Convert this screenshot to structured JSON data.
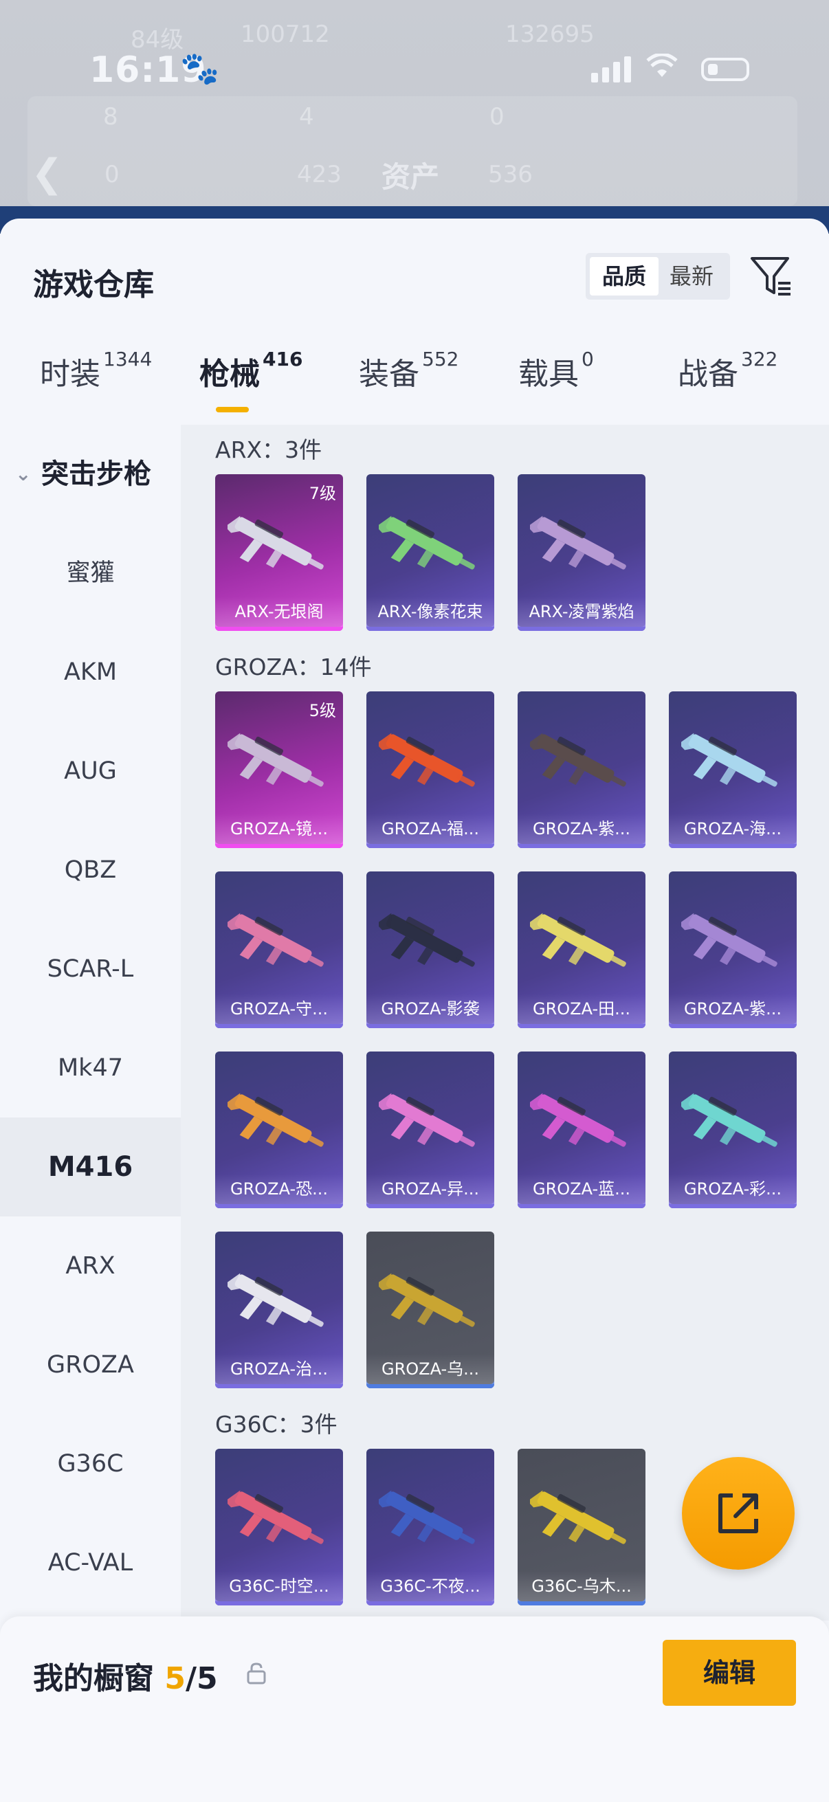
{
  "status_bar": {
    "time": "16:19",
    "paw_icon": "paw-icon"
  },
  "background": {
    "level_text": "84级",
    "stat_1": "100712",
    "stat_2": "132695",
    "values": [
      "8",
      "4",
      "0",
      "0",
      "423",
      "536"
    ],
    "asset_title": "资产"
  },
  "sheet": {
    "title": "游戏仓库",
    "sort_options": [
      "品质",
      "最新"
    ],
    "tabs": [
      {
        "label": "时装",
        "count": "1344"
      },
      {
        "label": "枪械",
        "count": "416"
      },
      {
        "label": "装备",
        "count": "552"
      },
      {
        "label": "载具",
        "count": "0"
      },
      {
        "label": "战备",
        "count": "322"
      }
    ]
  },
  "sidebar": {
    "header": "突击步枪",
    "items": [
      "蜜獾",
      "AKM",
      "AUG",
      "QBZ",
      "SCAR-L",
      "Mk47",
      "M416",
      "ARX",
      "GROZA",
      "G36C",
      "AC-VAL"
    ],
    "selected": "M416"
  },
  "groups": [
    {
      "label": "ARX：3件",
      "items": [
        {
          "name": "ARX-无垠阁",
          "level": "7级",
          "rarity": "purple",
          "color": "#d9d9e6"
        },
        {
          "name": "ARX-像素花束",
          "level": "",
          "rarity": "blue",
          "color": "#7fd27a"
        },
        {
          "name": "ARX-凌霄紫焰",
          "level": "",
          "rarity": "blue",
          "color": "#b79ad4"
        }
      ]
    },
    {
      "label": "GROZA：14件",
      "items": [
        {
          "name": "GROZA-镜...",
          "level": "5级",
          "rarity": "purple",
          "color": "#c9b9d6"
        },
        {
          "name": "GROZA-福...",
          "level": "",
          "rarity": "blue",
          "color": "#e8552a"
        },
        {
          "name": "GROZA-紫...",
          "level": "",
          "rarity": "blue",
          "color": "#5a4c4c"
        },
        {
          "name": "GROZA-海...",
          "level": "",
          "rarity": "blue",
          "color": "#a9d7ee"
        },
        {
          "name": "GROZA-守...",
          "level": "",
          "rarity": "blue",
          "color": "#e07aa8"
        },
        {
          "name": "GROZA-影袭",
          "level": "",
          "rarity": "blue",
          "color": "#2b2f45"
        },
        {
          "name": "GROZA-田...",
          "level": "",
          "rarity": "blue",
          "color": "#e4d86a"
        },
        {
          "name": "GROZA-紫...",
          "level": "",
          "rarity": "blue",
          "color": "#a487d4"
        },
        {
          "name": "GROZA-恐...",
          "level": "",
          "rarity": "blue",
          "color": "#e89a3c"
        },
        {
          "name": "GROZA-异...",
          "level": "",
          "rarity": "blue",
          "color": "#e27ad2"
        },
        {
          "name": "GROZA-蓝...",
          "level": "",
          "rarity": "blue",
          "color": "#d45bd0"
        },
        {
          "name": "GROZA-彩...",
          "level": "",
          "rarity": "blue",
          "color": "#6fd6d0"
        },
        {
          "name": "GROZA-治...",
          "level": "",
          "rarity": "blue",
          "color": "#e6e6ee"
        },
        {
          "name": "GROZA-乌...",
          "level": "",
          "rarity": "gray",
          "color": "#c9a532"
        }
      ]
    },
    {
      "label": "G36C：3件",
      "items": [
        {
          "name": "G36C-时空...",
          "level": "",
          "rarity": "blue",
          "color": "#e35f7a"
        },
        {
          "name": "G36C-不夜...",
          "level": "",
          "rarity": "blue",
          "color": "#3f5fc4"
        },
        {
          "name": "G36C-乌木...",
          "level": "",
          "rarity": "gray",
          "color": "#e0c12e"
        }
      ]
    }
  ],
  "bottom": {
    "title": "我的橱窗",
    "used": "5",
    "total": "/5",
    "edit_label": "编辑"
  }
}
